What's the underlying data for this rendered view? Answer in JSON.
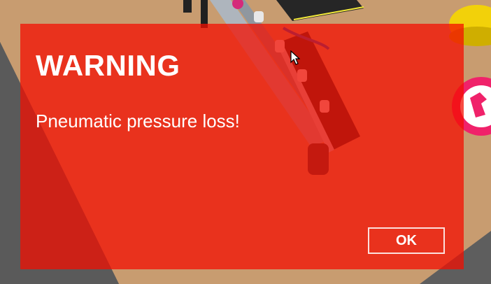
{
  "dialog": {
    "title": "WARNING",
    "message": "Pneumatic pressure loss!",
    "ok_label": "OK"
  },
  "colors": {
    "overlay": "#f40e00",
    "floor": "#c79a6e",
    "outer_floor": "#5e5e5e",
    "conveyor_belt": "#2a2a2a",
    "conveyor_rail": "#b8bfc8",
    "robot_yellow": "#f2d10a"
  },
  "icons": {
    "cursor": "mouse-pointer-icon",
    "sign": "hazard-sign-icon"
  }
}
